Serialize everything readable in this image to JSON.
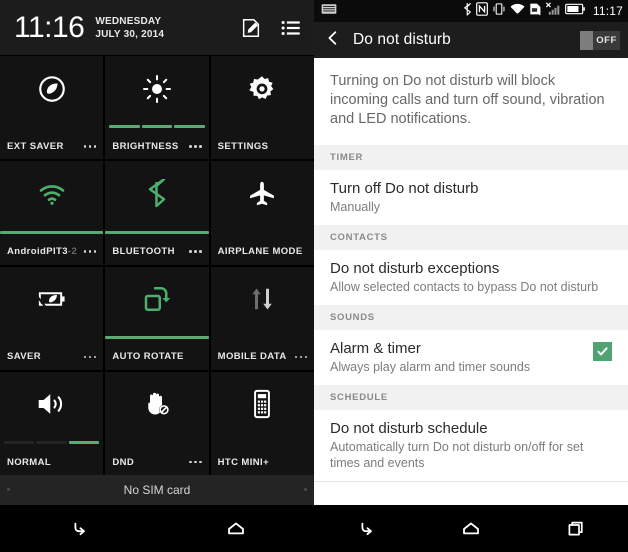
{
  "quick_settings": {
    "clock": "11:16",
    "date_line1": "WEDNESDAY",
    "date_line2": "JULY 30, 2014",
    "edit_icon": "edit-icon",
    "list_icon": "list-icon",
    "sim_status": "No SIM card",
    "tiles": [
      {
        "label": "EXT SAVER",
        "icon": "extreme-power-saver-icon",
        "has_menu": true,
        "state": "off",
        "bar": "none"
      },
      {
        "label": "BRIGHTNESS",
        "icon": "brightness-icon",
        "has_menu": true,
        "state": "off",
        "bar": "segments-3-all-on"
      },
      {
        "label": "SETTINGS",
        "icon": "gear-icon",
        "has_menu": false,
        "state": "off",
        "bar": "none"
      },
      {
        "label": "AndroidPIT3",
        "label_suffix": "-2",
        "icon": "wifi-icon",
        "has_menu": true,
        "state": "active",
        "bar": "solid-on"
      },
      {
        "label": "BLUETOOTH",
        "icon": "bluetooth-icon",
        "has_menu": true,
        "state": "active",
        "bar": "solid-on"
      },
      {
        "label": "AIRPLANE MODE",
        "icon": "airplane-icon",
        "has_menu": false,
        "state": "off",
        "bar": "none"
      },
      {
        "label": "SAVER",
        "icon": "power-saver-icon",
        "has_menu": true,
        "state": "off",
        "bar": "none"
      },
      {
        "label": "AUTO ROTATE",
        "icon": "auto-rotate-icon",
        "has_menu": false,
        "state": "active",
        "bar": "solid-on"
      },
      {
        "label": "MOBILE DATA",
        "icon": "mobile-data-icon",
        "has_menu": true,
        "state": "disabled",
        "bar": "none"
      },
      {
        "label": "NORMAL",
        "icon": "speaker-icon",
        "has_menu": false,
        "state": "off",
        "bar": "segments-3-last-on"
      },
      {
        "label": "DND",
        "icon": "do-not-disturb-icon",
        "has_menu": true,
        "state": "off",
        "bar": "none"
      },
      {
        "label": "HTC MINI+",
        "icon": "htc-mini-icon",
        "has_menu": false,
        "state": "off",
        "bar": "none"
      }
    ],
    "nav": {
      "back": "back-icon",
      "home": "home-icon"
    }
  },
  "settings": {
    "statusbar": {
      "clock": "11:17",
      "icons": [
        "keyboard-icon",
        "bluetooth-icon",
        "nfc-icon",
        "vibrate-icon",
        "wifi-icon",
        "sim-error-icon",
        "signal-no-service-icon",
        "battery-icon"
      ]
    },
    "actionbar": {
      "back_icon": "back-chevron-icon",
      "title": "Do not disturb",
      "toggle_label": "OFF"
    },
    "description": "Turning on Do not disturb will block incoming calls and turn off sound, vibration and LED notifications.",
    "sections": [
      {
        "header": "TIMER",
        "rows": [
          {
            "title": "Turn off Do not disturb",
            "subtitle": "Manually",
            "checkbox": false
          }
        ]
      },
      {
        "header": "CONTACTS",
        "rows": [
          {
            "title": "Do not disturb exceptions",
            "subtitle": "Allow selected contacts to bypass Do not disturb",
            "checkbox": false
          }
        ]
      },
      {
        "header": "SOUNDS",
        "rows": [
          {
            "title": "Alarm & timer",
            "subtitle": "Always play alarm and timer sounds",
            "checkbox": true,
            "checked": true
          }
        ]
      },
      {
        "header": "SCHEDULE",
        "rows": [
          {
            "title": "Do not disturb schedule",
            "subtitle": "Automatically turn Do not disturb on/off for set times and events",
            "checkbox": false
          }
        ]
      }
    ],
    "nav": {
      "back": "back-icon",
      "home": "home-icon",
      "recents": "recents-icon"
    }
  },
  "colors": {
    "accent_green": "#5aaa73",
    "checkbox_green": "#4fa372",
    "tile_bg": "#131313",
    "panel_bg": "#000000"
  }
}
